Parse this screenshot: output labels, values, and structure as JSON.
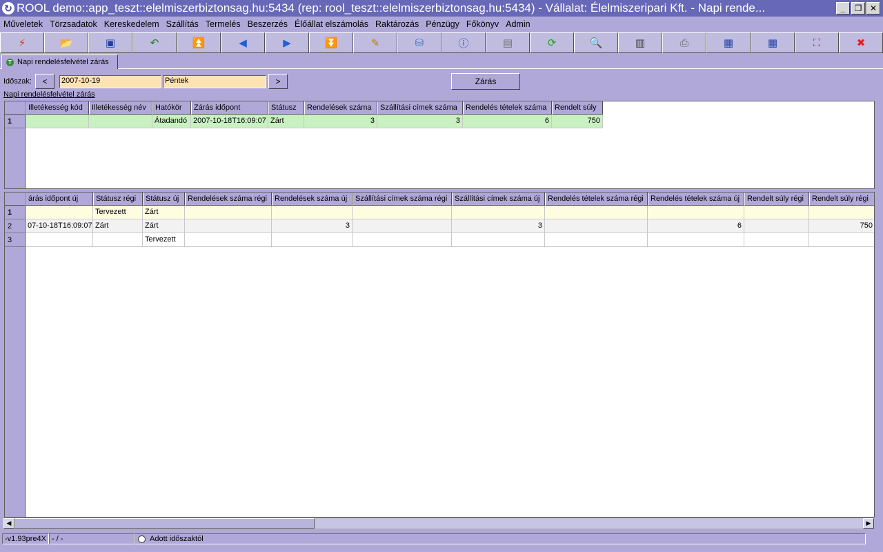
{
  "window": {
    "title": "ROOL demo::app_teszt::elelmiszerbiztonsag.hu:5434 (rep: rool_teszt::elelmiszerbiztonsag.hu:5434) - Vállalat: Élelmiszeripari Kft. - Napi rende...",
    "minimize": "_",
    "restore": "❐",
    "close": "✕"
  },
  "menu": [
    "Műveletek",
    "Törzsadatok",
    "Kereskedelem",
    "Szállítás",
    "Termelés",
    "Beszerzés",
    "Élőállat elszámolás",
    "Raktározás",
    "Pénzügy",
    "Főkönyv",
    "Admin"
  ],
  "toolbar": [
    {
      "icon": "lightning-icon",
      "glyph": "⚡",
      "color": "#d04010"
    },
    {
      "icon": "open-folder-icon",
      "glyph": "📂",
      "color": "#3050b0"
    },
    {
      "icon": "save-icon",
      "glyph": "▣",
      "color": "#2040a0"
    },
    {
      "icon": "undo-icon",
      "glyph": "↶",
      "color": "#208020"
    },
    {
      "icon": "first-record-icon",
      "glyph": "⏫",
      "color": "#2060d0"
    },
    {
      "icon": "previous-icon",
      "glyph": "◀",
      "color": "#2060d0"
    },
    {
      "icon": "next-icon",
      "glyph": "▶",
      "color": "#2060d0"
    },
    {
      "icon": "last-record-icon",
      "glyph": "⏬",
      "color": "#2060d0"
    },
    {
      "icon": "edit-icon",
      "glyph": "✎",
      "color": "#c08000"
    },
    {
      "icon": "database-icon",
      "glyph": "⛁",
      "color": "#3070c0"
    },
    {
      "icon": "info-icon",
      "glyph": "ⓘ",
      "color": "#1050c0"
    },
    {
      "icon": "form-view-icon",
      "glyph": "▤",
      "color": "#707070"
    },
    {
      "icon": "refresh-icon",
      "glyph": "⟳",
      "color": "#20a020"
    },
    {
      "icon": "search-icon",
      "glyph": "🔍",
      "color": "#c08000"
    },
    {
      "icon": "column-layout-icon",
      "glyph": "▥",
      "color": "#404040"
    },
    {
      "icon": "print-icon",
      "glyph": "⎙",
      "color": "#606060"
    },
    {
      "icon": "export-grid-icon",
      "glyph": "▦",
      "color": "#2040a0"
    },
    {
      "icon": "import-grid-icon",
      "glyph": "▦",
      "color": "#2040a0"
    },
    {
      "icon": "fullscreen-icon",
      "glyph": "⛶",
      "color": "#c02020"
    },
    {
      "icon": "exit-icon",
      "glyph": "✖",
      "color": "#e02020"
    }
  ],
  "tab": {
    "label": "Napi rendelésfelvétel zárás"
  },
  "filter": {
    "label": "Időszak:",
    "prev": "<",
    "date": "2007-10-19",
    "weekday": "Péntek",
    "next": ">"
  },
  "zaras_button": "Zárás",
  "section_title": "Napi rendelésfelvétel zárás",
  "top_grid": {
    "columns": [
      "Illetékesség kód",
      "Illetékesség név",
      "Hatókör",
      "Zárás időpont",
      "Státusz",
      "Rendelések száma",
      "Szállítási címek száma",
      "Rendelés tételek száma",
      "Rendelt súly"
    ],
    "rows": [
      {
        "num": "1",
        "cells": [
          "",
          "",
          "Átadandó",
          "2007-10-18T16:09:07",
          "Zárt",
          "3",
          "3",
          "6",
          "750"
        ]
      }
    ]
  },
  "bottom_grid": {
    "columns": [
      "árás időpont új",
      "Státusz régi",
      "Státusz új",
      "Rendelések száma régi",
      "Rendelések száma új",
      "Szállítási címek száma régi",
      "Szállítási címek száma új",
      "Rendelés tételek száma régi",
      "Rendelés tételek száma új",
      "Rendelt súly régi",
      "Rendelt súly régi"
    ],
    "rows": [
      {
        "num": "1",
        "cells": [
          "",
          "Tervezett",
          "Zárt",
          "",
          "",
          "",
          "",
          "",
          "",
          "",
          ""
        ]
      },
      {
        "num": "2",
        "cells": [
          "07-10-18T16:09:07",
          "Zárt",
          "Zárt",
          "",
          "3",
          "",
          "3",
          "",
          "6",
          "",
          "750"
        ]
      },
      {
        "num": "3",
        "cells": [
          "",
          "",
          "Tervezett",
          "",
          "",
          "",
          "",
          "",
          "",
          "",
          ""
        ]
      }
    ]
  },
  "scroll": {
    "left": "◀",
    "right": "▶"
  },
  "status": {
    "version": "-v1.93pre4X",
    "mode": "- / -",
    "option": "Adott időszaktól"
  }
}
